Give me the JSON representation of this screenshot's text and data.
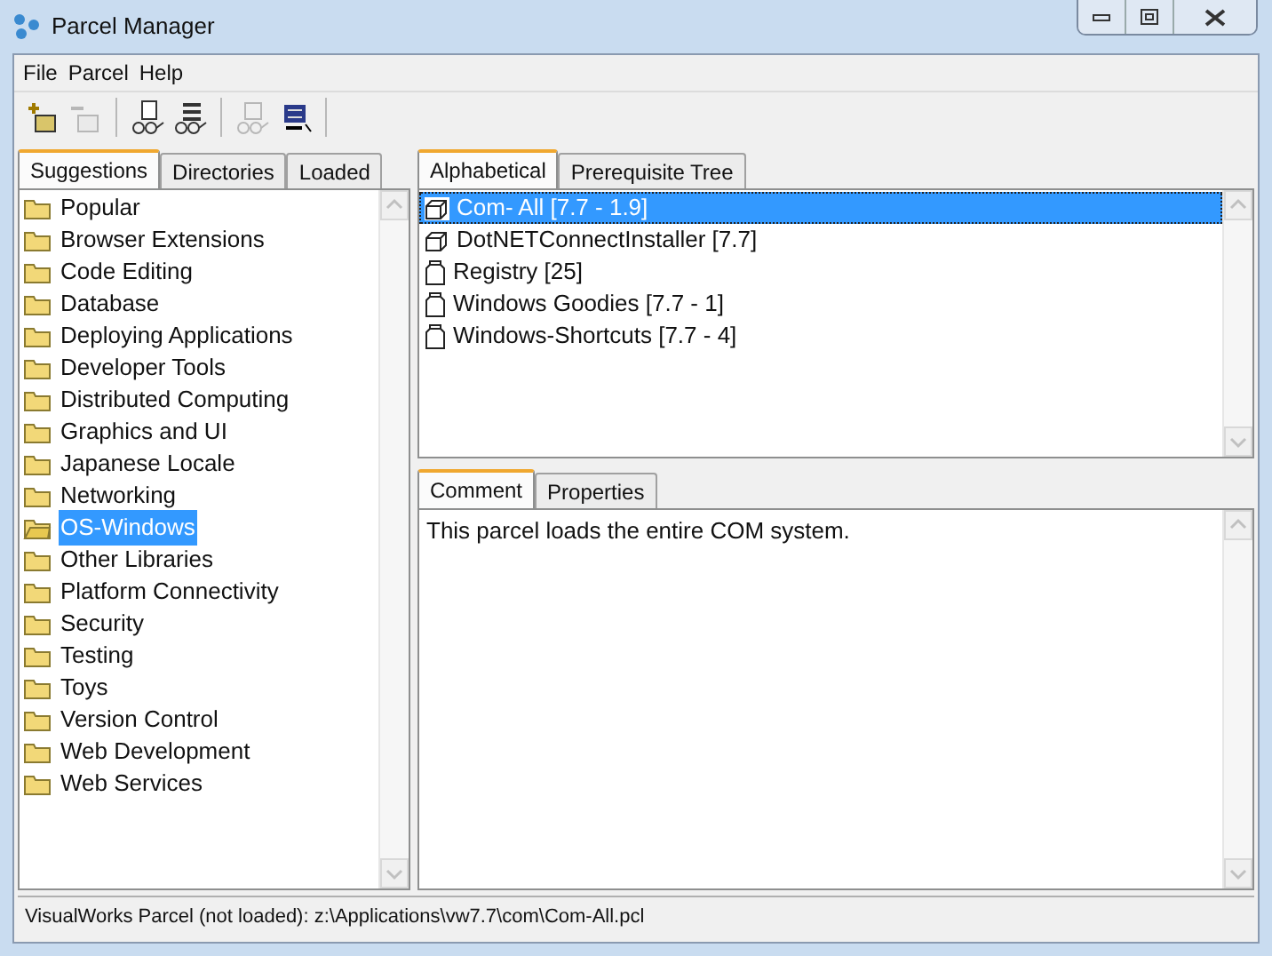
{
  "window": {
    "title": "Parcel Manager"
  },
  "menu": [
    "File",
    "Parcel",
    "Help"
  ],
  "toolbar": [
    {
      "kind": "add",
      "disabled": false
    },
    {
      "kind": "remove",
      "disabled": true
    },
    {
      "kind": "browse-doc",
      "disabled": false
    },
    {
      "kind": "browse-list",
      "disabled": false
    },
    {
      "kind": "browse-parcel",
      "disabled": true
    },
    {
      "kind": "publish",
      "disabled": false
    }
  ],
  "left_tabs": [
    {
      "label": "Suggestions",
      "selected": true
    },
    {
      "label": "Directories",
      "selected": false
    },
    {
      "label": "Loaded",
      "selected": false
    }
  ],
  "folders": [
    {
      "label": "Popular",
      "selected": false
    },
    {
      "label": "Browser Extensions",
      "selected": false
    },
    {
      "label": "Code Editing",
      "selected": false
    },
    {
      "label": "Database",
      "selected": false
    },
    {
      "label": "Deploying Applications",
      "selected": false
    },
    {
      "label": "Developer Tools",
      "selected": false
    },
    {
      "label": "Distributed Computing",
      "selected": false
    },
    {
      "label": "Graphics and UI",
      "selected": false
    },
    {
      "label": "Japanese Locale",
      "selected": false
    },
    {
      "label": "Networking",
      "selected": false
    },
    {
      "label": "OS-Windows",
      "selected": true
    },
    {
      "label": "Other Libraries",
      "selected": false
    },
    {
      "label": "Platform Connectivity",
      "selected": false
    },
    {
      "label": "Security",
      "selected": false
    },
    {
      "label": "Testing",
      "selected": false
    },
    {
      "label": "Toys",
      "selected": false
    },
    {
      "label": "Version Control",
      "selected": false
    },
    {
      "label": "Web Development",
      "selected": false
    },
    {
      "label": "Web Services",
      "selected": false
    }
  ],
  "parcel_tabs": [
    {
      "label": "Alphabetical",
      "selected": true
    },
    {
      "label": "Prerequisite Tree",
      "selected": false
    }
  ],
  "parcels": [
    {
      "label": "Com- All [7.7 - 1.9]",
      "kind": "cube",
      "selected": true
    },
    {
      "label": "DotNETConnectInstaller [7.7]",
      "kind": "cube",
      "selected": false
    },
    {
      "label": "Registry [25]",
      "kind": "jar",
      "selected": false
    },
    {
      "label": "Windows Goodies [7.7 - 1]",
      "kind": "jar",
      "selected": false
    },
    {
      "label": "Windows-Shortcuts [7.7 - 4]",
      "kind": "jar",
      "selected": false
    }
  ],
  "detail_tabs": [
    {
      "label": "Comment",
      "selected": true
    },
    {
      "label": "Properties",
      "selected": false
    }
  ],
  "comment": "This parcel loads the entire COM system.",
  "status_bar": "VisualWorks Parcel (not loaded): z:\\Applications\\vw7.7\\com\\Com-All.pcl"
}
